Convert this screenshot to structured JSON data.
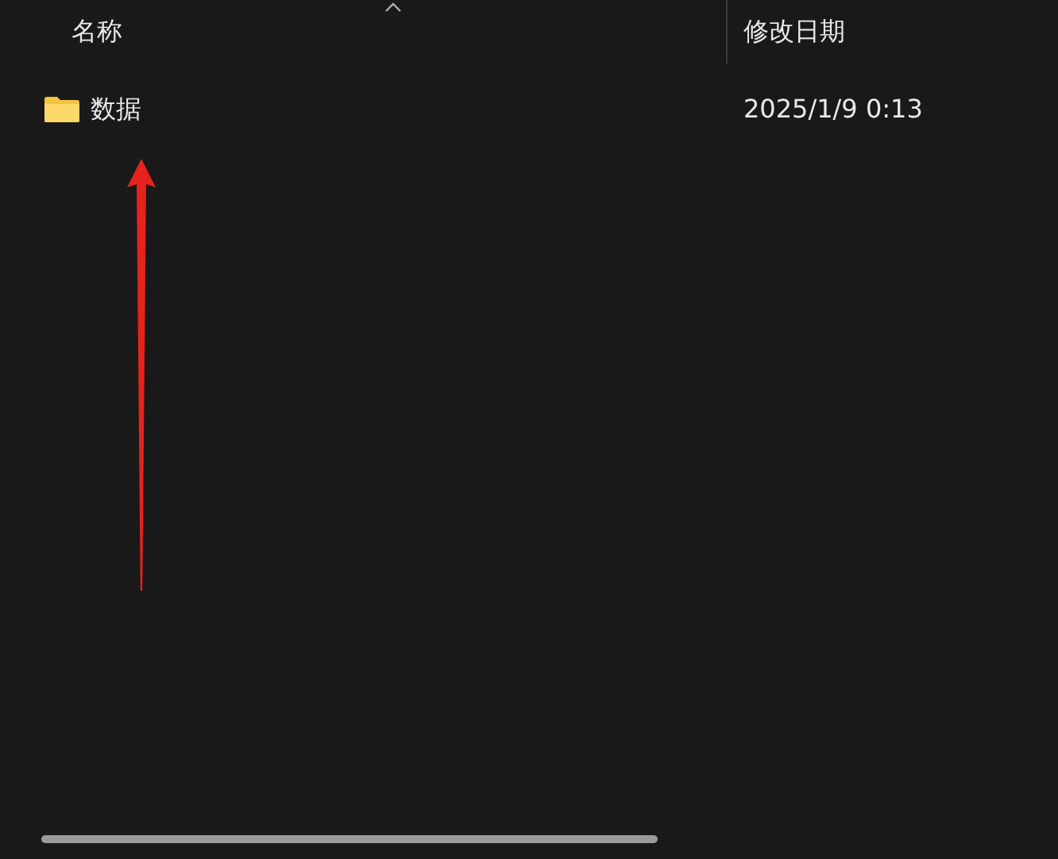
{
  "columns": [
    {
      "label": "名称"
    },
    {
      "label": "修改日期"
    }
  ],
  "rows": [
    {
      "kind": "folder",
      "name": "数据",
      "modified": "2025/1/9 0:13"
    }
  ]
}
